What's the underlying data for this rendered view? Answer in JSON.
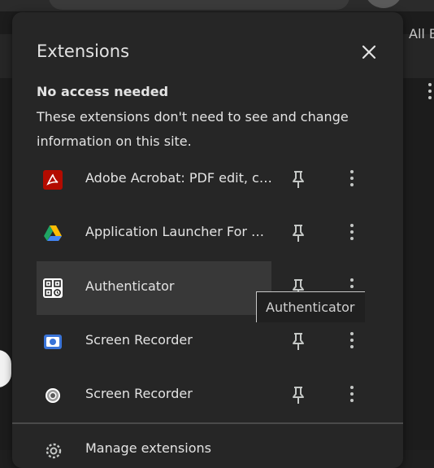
{
  "background": {
    "right_label": "All B"
  },
  "panel": {
    "title": "Extensions",
    "close_icon": "close-icon",
    "section_heading": "No access needed",
    "section_description": "These extensions don't need to see and change information on this site.",
    "extensions": [
      {
        "name": "Adobe Acrobat: PDF edit, convert, sign tools",
        "icon": "adobe-acrobat-icon",
        "color": "#b30b00"
      },
      {
        "name": "Application Launcher For Drive (by Google)",
        "icon": "google-drive-icon",
        "color": "#1fa463"
      },
      {
        "name": "Authenticator",
        "icon": "qr-code-icon",
        "color": "#ffffff",
        "hovered": true
      },
      {
        "name": "Screen Recorder",
        "icon": "screen-recorder-blue-icon",
        "color": "#3a74d8"
      },
      {
        "name": "Screen Recorder",
        "icon": "screen-recorder-gray-icon",
        "color": "#bdbdbd"
      }
    ],
    "manage_label": "Manage extensions"
  },
  "tooltip": {
    "text": "Authenticator"
  },
  "colors": {
    "panel_bg": "#262626",
    "text": "#e3e3e3",
    "hover_bg": "#383838"
  }
}
